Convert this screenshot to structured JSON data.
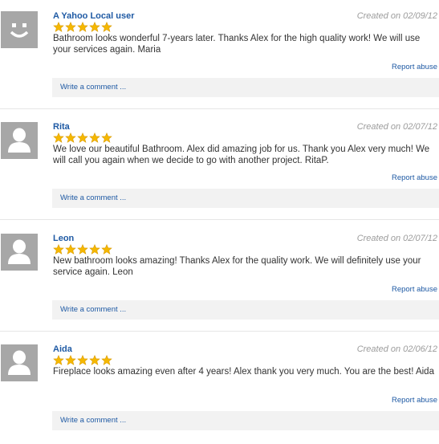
{
  "reviews": [
    {
      "name": "A Yahoo Local user",
      "date": "Created on 02/09/12",
      "rating": 5,
      "avatar": "smiley-avatar",
      "text": "Bathroom looks wonderful 7-years later. Thanks Alex for the high quality work! We will use your services again. Maria",
      "report": "Report abuse",
      "comment": "Write a comment ..."
    },
    {
      "name": "Rita",
      "date": "Created on 02/07/12",
      "rating": 5,
      "avatar": "person-avatar",
      "text": "We love our beautiful Bathroom. Alex did amazing job for us. Thank you Alex very much! We will call you again when we decide to go with another project. RitaP.",
      "report": "Report abuse",
      "comment": "Write a comment ..."
    },
    {
      "name": "Leon",
      "date": "Created on 02/07/12",
      "rating": 5,
      "avatar": "person-avatar",
      "text": "New bathroom looks amazing! Thanks Alex for the quality work. We will definitely use your service again. Leon",
      "report": "Report abuse",
      "comment": "Write a comment ..."
    },
    {
      "name": "Aida",
      "date": "Created on 02/06/12",
      "rating": 5,
      "avatar": "person-avatar",
      "text": "Fireplace looks amazing even after 4 years! Alex thank you very much. You are the best! Aida",
      "report": "Report abuse",
      "comment": "Write a comment ..."
    }
  ],
  "colors": {
    "link": "#1f5aa4",
    "star": "#f5b800",
    "avatar_bg": "#a7a7a7"
  }
}
